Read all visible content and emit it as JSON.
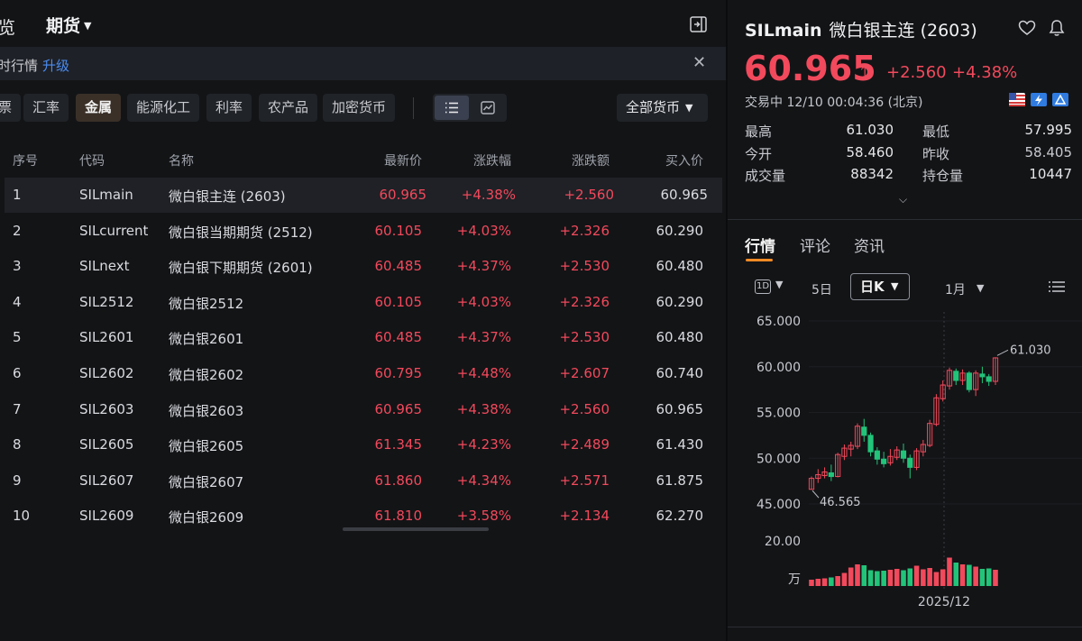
{
  "header": {
    "crumb": "览",
    "market": "期货"
  },
  "notice": {
    "text": "时行情",
    "upgrade": "升级"
  },
  "filters": {
    "chips": [
      "票",
      "汇率",
      "金属",
      "能源化工",
      "利率",
      "农产品",
      "加密货币"
    ],
    "active": "金属",
    "currency": "全部货币"
  },
  "table": {
    "headers": [
      "序号",
      "代码",
      "名称",
      "最新价",
      "涨跌幅",
      "涨跌额",
      "买入价"
    ],
    "rows": [
      [
        "1",
        "SILmain",
        "微白银主连 (2603)",
        "60.965",
        "+4.38%",
        "+2.560",
        "60.965"
      ],
      [
        "2",
        "SILcurrent",
        "微白银当期期货 (2512)",
        "60.105",
        "+4.03%",
        "+2.326",
        "60.290"
      ],
      [
        "3",
        "SILnext",
        "微白银下期期货 (2601)",
        "60.485",
        "+4.37%",
        "+2.530",
        "60.480"
      ],
      [
        "4",
        "SIL2512",
        "微白银2512",
        "60.105",
        "+4.03%",
        "+2.326",
        "60.290"
      ],
      [
        "5",
        "SIL2601",
        "微白银2601",
        "60.485",
        "+4.37%",
        "+2.530",
        "60.480"
      ],
      [
        "6",
        "SIL2602",
        "微白银2602",
        "60.795",
        "+4.48%",
        "+2.607",
        "60.740"
      ],
      [
        "7",
        "SIL2603",
        "微白银2603",
        "60.965",
        "+4.38%",
        "+2.560",
        "60.965"
      ],
      [
        "8",
        "SIL2605",
        "微白银2605",
        "61.345",
        "+4.23%",
        "+2.489",
        "61.430"
      ],
      [
        "9",
        "SIL2607",
        "微白银2607",
        "61.860",
        "+4.34%",
        "+2.571",
        "61.875"
      ],
      [
        "10",
        "SIL2609",
        "微白银2609",
        "61.810",
        "+3.58%",
        "+2.134",
        "62.270"
      ]
    ]
  },
  "quote": {
    "symbol": "SILmain",
    "name": "微白银主连 (2603)",
    "price": "60.965",
    "change": "+2.560",
    "change_pct": "+4.38%",
    "status": "交易中 12/10 00:04:36 (北京)",
    "high_label": "最高",
    "high": "61.030",
    "low_label": "最低",
    "low": "57.995",
    "open_label": "今开",
    "open": "58.460",
    "prev_label": "昨收",
    "prev": "58.405",
    "volume_label": "成交量",
    "volume": "88342",
    "oi_label": "持仓量",
    "oi": "10447"
  },
  "tabs": [
    "行情",
    "评论",
    "资讯"
  ],
  "periods": {
    "p1d": "1D",
    "p5d": "5日",
    "dayk": "日K",
    "month": "1月"
  },
  "colors": {
    "up": "#f2495c",
    "down": "#22c47a",
    "accent": "#f08a24",
    "link": "#4b8cf0"
  },
  "chart_data": {
    "type": "candlestick",
    "y_ticks": [
      "65.000",
      "60.000",
      "55.000",
      "50.000",
      "45.000"
    ],
    "ylim": [
      45,
      65
    ],
    "high_label": "61.030",
    "low_label": "46.565",
    "volume_ticks": [
      "20.00",
      "万"
    ],
    "volume_ylim": [
      0,
      20
    ],
    "x_label": "2025/12",
    "candles": [
      [
        46.6,
        47.8,
        46.565,
        48.0
      ],
      [
        47.8,
        48.2,
        47.3,
        48.8
      ],
      [
        48.1,
        48.5,
        47.8,
        49.0
      ],
      [
        48.4,
        48.0,
        47.5,
        49.3
      ],
      [
        48.0,
        50.4,
        47.9,
        50.6
      ],
      [
        50.2,
        51.1,
        49.8,
        51.5
      ],
      [
        51.0,
        51.4,
        50.2,
        51.8
      ],
      [
        51.3,
        53.5,
        51.0,
        53.8
      ],
      [
        53.4,
        52.5,
        51.8,
        54.3
      ],
      [
        52.5,
        50.7,
        50.2,
        52.8
      ],
      [
        50.8,
        49.9,
        49.3,
        51.2
      ],
      [
        49.9,
        49.4,
        49.0,
        50.7
      ],
      [
        49.5,
        50.2,
        49.2,
        51.0
      ],
      [
        50.1,
        50.9,
        49.8,
        51.3
      ],
      [
        50.8,
        50.0,
        49.5,
        51.6
      ],
      [
        50.0,
        49.0,
        47.8,
        50.4
      ],
      [
        49.0,
        50.8,
        48.7,
        51.1
      ],
      [
        50.7,
        51.5,
        50.2,
        52.0
      ],
      [
        51.4,
        53.8,
        51.2,
        54.2
      ],
      [
        53.7,
        56.6,
        53.5,
        57.0
      ],
      [
        56.5,
        58.0,
        56.2,
        58.5
      ],
      [
        57.9,
        59.6,
        57.5,
        59.9
      ],
      [
        59.5,
        58.5,
        58.0,
        59.8
      ],
      [
        58.5,
        59.3,
        58.0,
        59.7
      ],
      [
        59.3,
        57.5,
        57.2,
        59.5
      ],
      [
        57.5,
        59.3,
        56.8,
        59.6
      ],
      [
        59.2,
        58.9,
        58.2,
        60.0
      ],
      [
        58.9,
        58.4,
        57.9,
        59.2
      ],
      [
        58.4,
        60.965,
        58.0,
        61.03
      ]
    ],
    "volumes": [
      2.8,
      3.2,
      3.4,
      3.8,
      4.4,
      5.8,
      8.2,
      9.6,
      9.2,
      7.0,
      6.6,
      6.8,
      7.2,
      7.6,
      7.0,
      7.8,
      9.0,
      7.4,
      8.0,
      6.2,
      7.4,
      12.6,
      10.4,
      9.6,
      9.4,
      8.6,
      7.6,
      7.8,
      7.2
    ]
  }
}
